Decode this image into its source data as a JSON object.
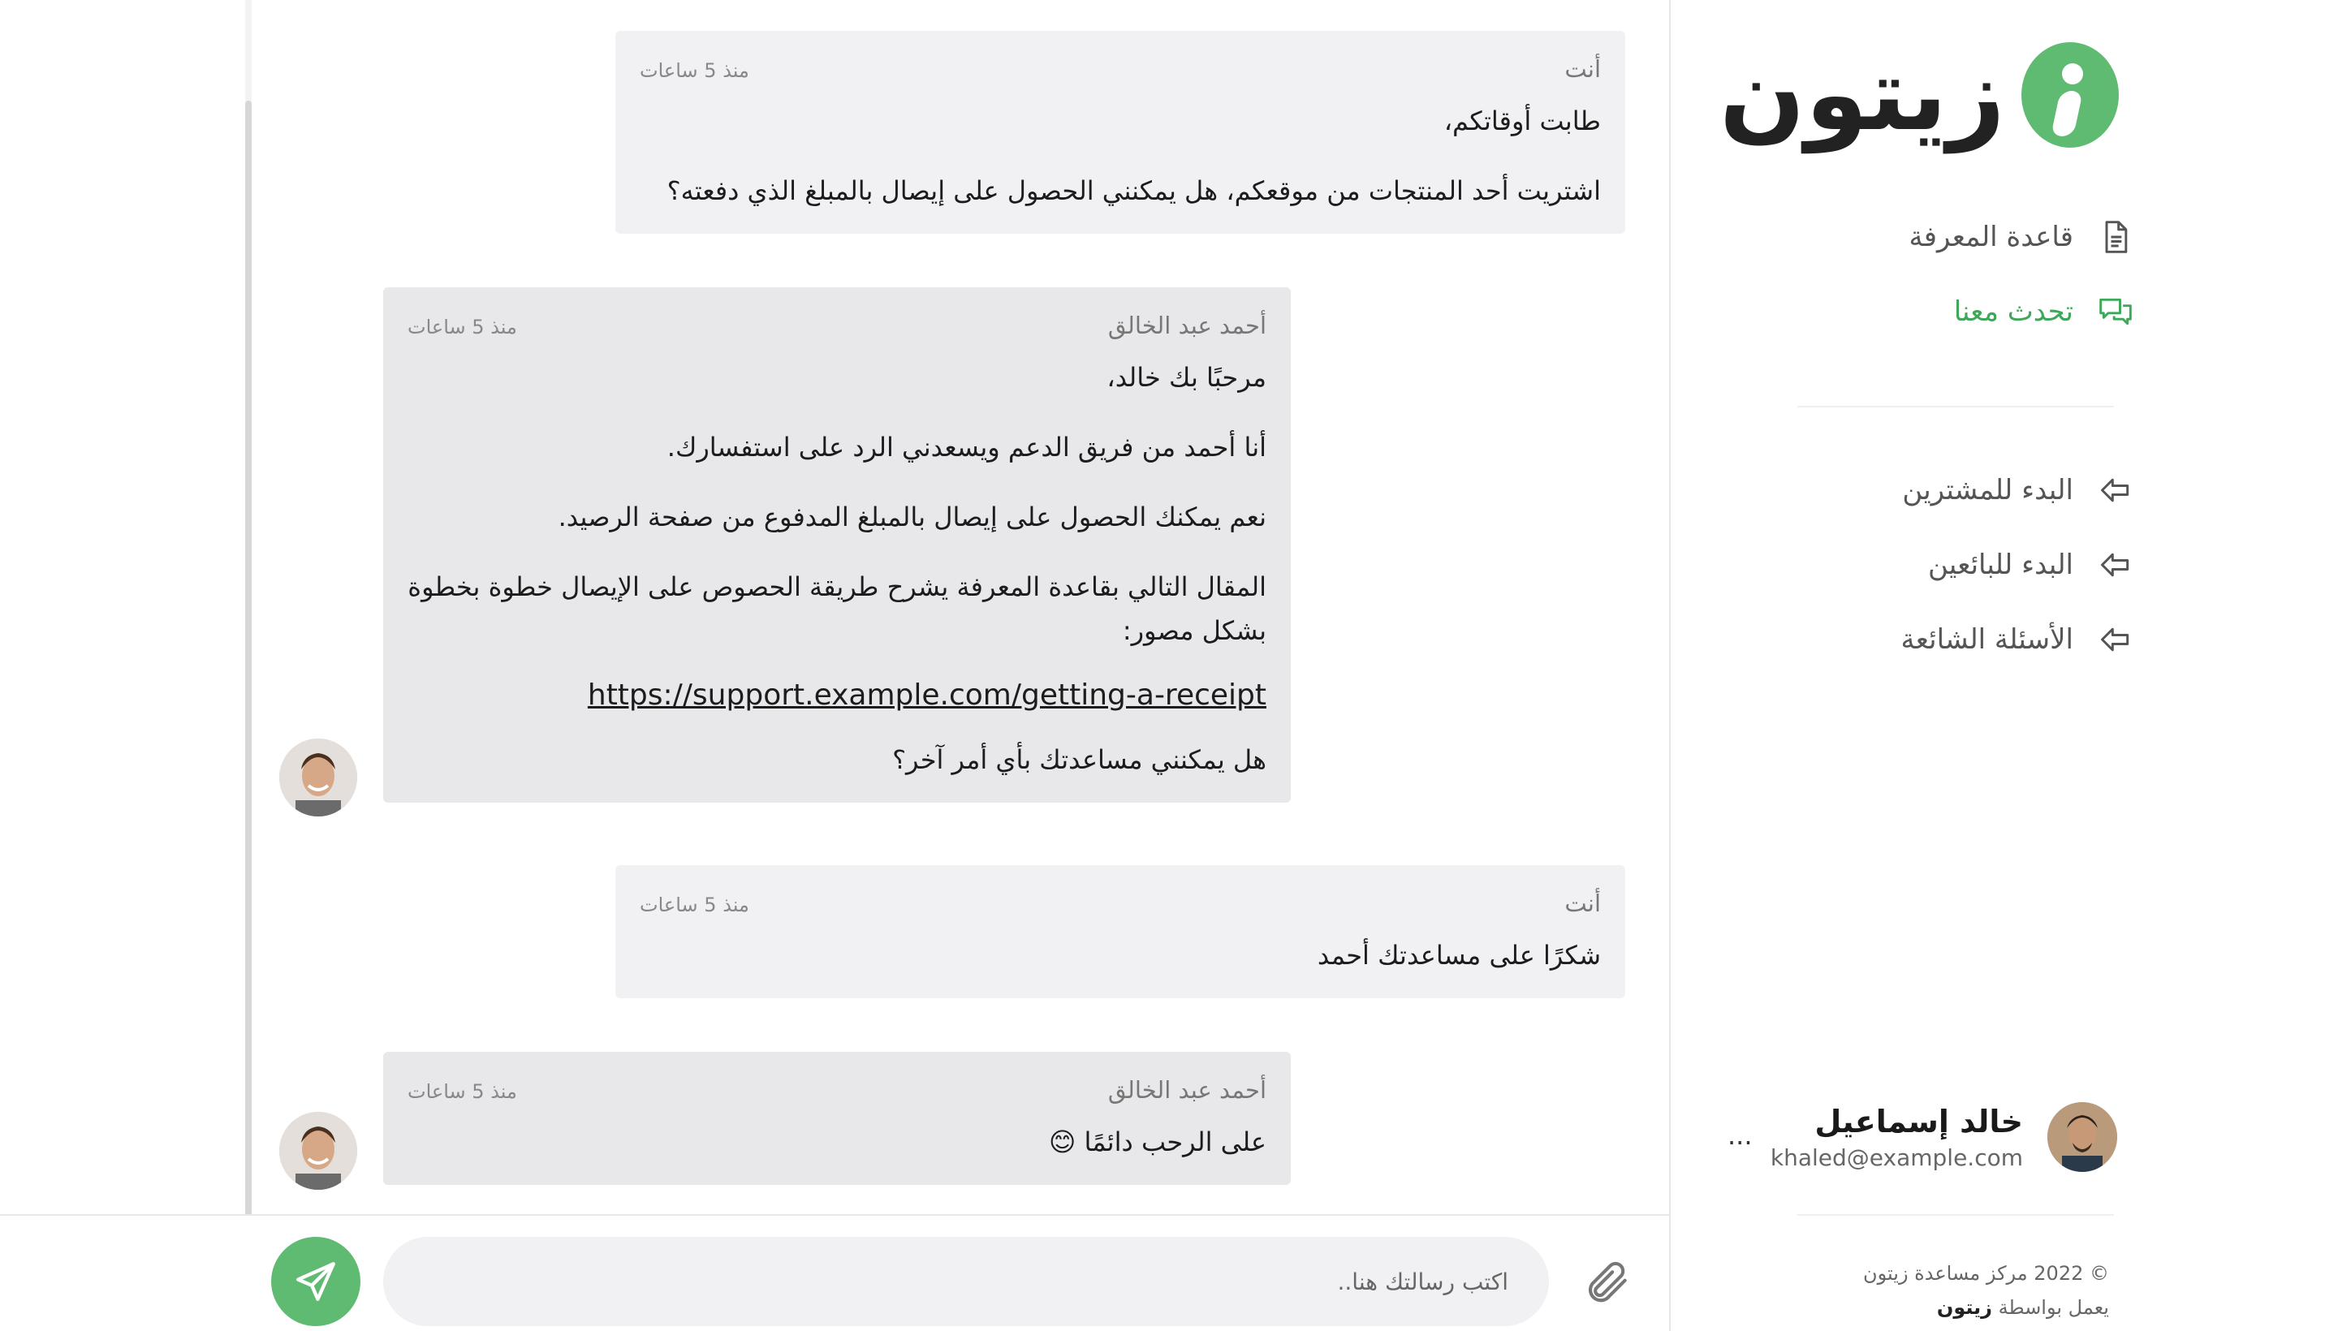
{
  "brand": {
    "name": "زيتون",
    "accent": "#5fbb72",
    "link_color": "#3ea85a"
  },
  "nav": {
    "primary": [
      {
        "label": "قاعدة المعرفة",
        "icon": "document-icon",
        "active": false
      },
      {
        "label": "تحدث معنا",
        "icon": "chat-bubbles-icon",
        "active": true
      }
    ],
    "secondary": [
      {
        "label": "البدء للمشترين",
        "icon": "arrow-left-icon"
      },
      {
        "label": "البدء للبائعين",
        "icon": "arrow-left-icon"
      },
      {
        "label": "الأسئلة الشائعة",
        "icon": "arrow-left-icon"
      }
    ]
  },
  "user": {
    "name": "خالد إسماعيل",
    "email": "khaled@example.com",
    "more": "..."
  },
  "footer": {
    "copyright": "© 2022 مركز مساعدة زيتون",
    "powered_prefix": "يعمل بواسطة",
    "powered_brand": "زيتون"
  },
  "messages": [
    {
      "author": "أنت",
      "time": "منذ 5 ساعات",
      "lines": [
        "طابت أوقاتكم،",
        "اشتريت أحد المنتجات من موقعكم، هل يمكنني الحصول على إيصال بالمبلغ الذي دفعته؟"
      ]
    },
    {
      "author": "أحمد عبد الخالق",
      "time": "منذ 5 ساعات",
      "lines": [
        "مرحبًا بك خالد،",
        "أنا أحمد من فريق الدعم ويسعدني الرد على استفسارك.",
        "نعم يمكنك الحصول على إيصال بالمبلغ المدفوع من صفحة الرصيد.",
        "المقال التالي بقاعدة المعرفة يشرح طريقة الحصوص على الإيصال خطوة بخطوة بشكل مصور:",
        "https://support.example.com/getting-a-receipt",
        "هل يمكنني مساعدتك بأي أمر آخر؟"
      ]
    },
    {
      "author": "أنت",
      "time": "منذ 5 ساعات",
      "lines": [
        "شكرًا على مساعدتك أحمد"
      ]
    },
    {
      "author": "أحمد عبد الخالق",
      "time": "منذ 5 ساعات",
      "lines": [
        "على الرحب دائمًا 😊"
      ]
    }
  ],
  "composer": {
    "placeholder": "اكتب رسالتك هنا.."
  }
}
